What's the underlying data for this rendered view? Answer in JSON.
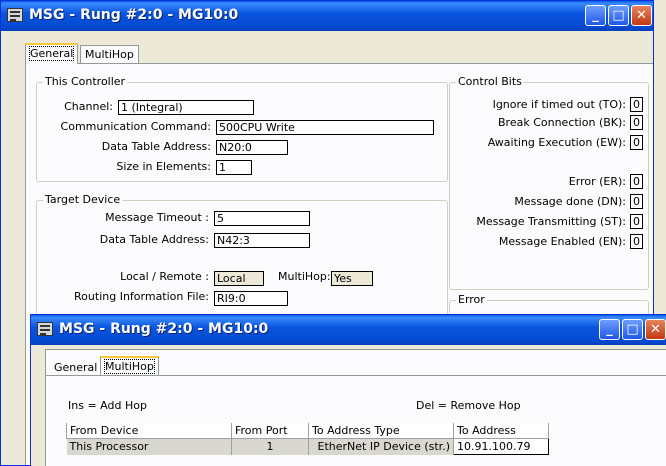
{
  "window_back": {
    "title": "MSG - Rung #2:0 - MG10:0",
    "tabs": [
      "General",
      "MultiHop"
    ],
    "this_controller": {
      "title": "This Controller",
      "channel_label": "Channel:",
      "channel_value": "1 (Integral)",
      "comm_command_label": "Communication Command:",
      "comm_command_value": "500CPU Write",
      "data_table_label": "Data Table Address:",
      "data_table_value": "N20:0",
      "size_label": "Size in Elements:",
      "size_value": "1"
    },
    "target_device": {
      "title": "Target Device",
      "timeout_label": "Message Timeout :",
      "timeout_value": "5",
      "data_table_label": "Data Table Address:",
      "data_table_value": "N42:3",
      "local_remote_label": "Local / Remote :",
      "local_remote_value": "Local",
      "multihop_label": "MultiHop:",
      "multihop_value": "Yes",
      "routing_label": "Routing Information File:",
      "routing_value": "RI9:0"
    },
    "control_bits": {
      "title": "Control Bits",
      "bits": [
        {
          "label": "Ignore if timed out (TO):",
          "value": "0"
        },
        {
          "label": "Break Connection (BK):",
          "value": "0"
        },
        {
          "label": "Awaiting Execution (EW):",
          "value": "0"
        },
        {
          "label": "Error (ER):",
          "value": "0"
        },
        {
          "label": "Message done (DN):",
          "value": "0"
        },
        {
          "label": "Message Transmitting (ST):",
          "value": "0"
        },
        {
          "label": "Message Enabled (EN):",
          "value": "0"
        }
      ]
    },
    "error": {
      "title": "Error"
    }
  },
  "window_front": {
    "title": "MSG - Rung #2:0 - MG10:0",
    "tabs": [
      "General",
      "MultiHop"
    ],
    "ins_hint": "Ins = Add Hop",
    "del_hint": "Del = Remove Hop",
    "table": {
      "columns": [
        "From Device",
        "From Port",
        "To Address Type",
        "To Address"
      ],
      "rows": [
        [
          "This Processor",
          "1",
          "EtherNet IP Device (str.)",
          "10.91.100.79"
        ]
      ]
    }
  }
}
